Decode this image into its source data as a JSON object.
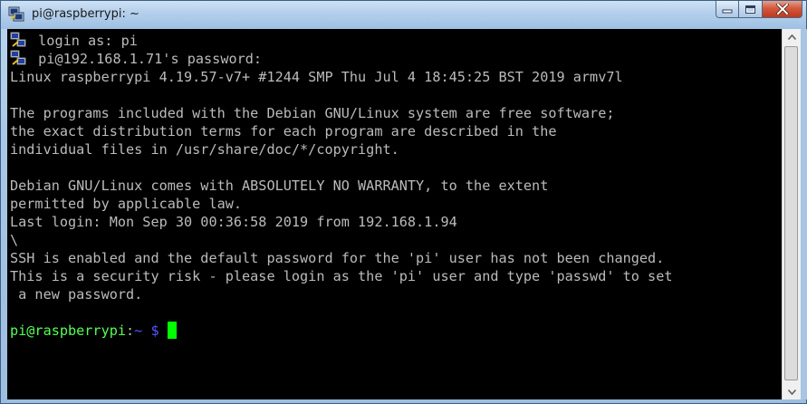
{
  "window": {
    "title": "pi@raspberrypi: ~",
    "icon": "putty-icon",
    "caption_buttons": [
      "minimize-icon",
      "maximize-icon",
      "close-icon"
    ]
  },
  "terminal": {
    "lines": [
      {
        "icon": "key-icon",
        "text": "login as: pi"
      },
      {
        "icon": "key-icon",
        "text": "pi@192.168.1.71's password:"
      },
      {
        "text": "Linux raspberrypi 4.19.57-v7+ #1244 SMP Thu Jul 4 18:45:25 BST 2019 armv7l"
      },
      {
        "text": ""
      },
      {
        "text": "The programs included with the Debian GNU/Linux system are free software;"
      },
      {
        "text": "the exact distribution terms for each program are described in the"
      },
      {
        "text": "individual files in /usr/share/doc/*/copyright."
      },
      {
        "text": ""
      },
      {
        "text": "Debian GNU/Linux comes with ABSOLUTELY NO WARRANTY, to the extent"
      },
      {
        "text": "permitted by applicable law."
      },
      {
        "text": "Last login: Mon Sep 30 00:36:58 2019 from 192.168.1.94"
      },
      {
        "text": "\\"
      },
      {
        "text": "SSH is enabled and the default password for the 'pi' user has not been changed."
      },
      {
        "text": "This is a security risk - please login as the 'pi' user and type 'passwd' to set"
      },
      {
        "text": " a new password."
      },
      {
        "text": ""
      }
    ],
    "prompt": {
      "user_host": "pi@raspberrypi",
      "separator": ":",
      "path": "~",
      "symbol": " $ "
    },
    "colors": {
      "background": "#000000",
      "text": "#bbbbbb",
      "prompt_green": "#54ff54",
      "prompt_blue": "#5454ff",
      "cursor": "#00ff00"
    }
  }
}
